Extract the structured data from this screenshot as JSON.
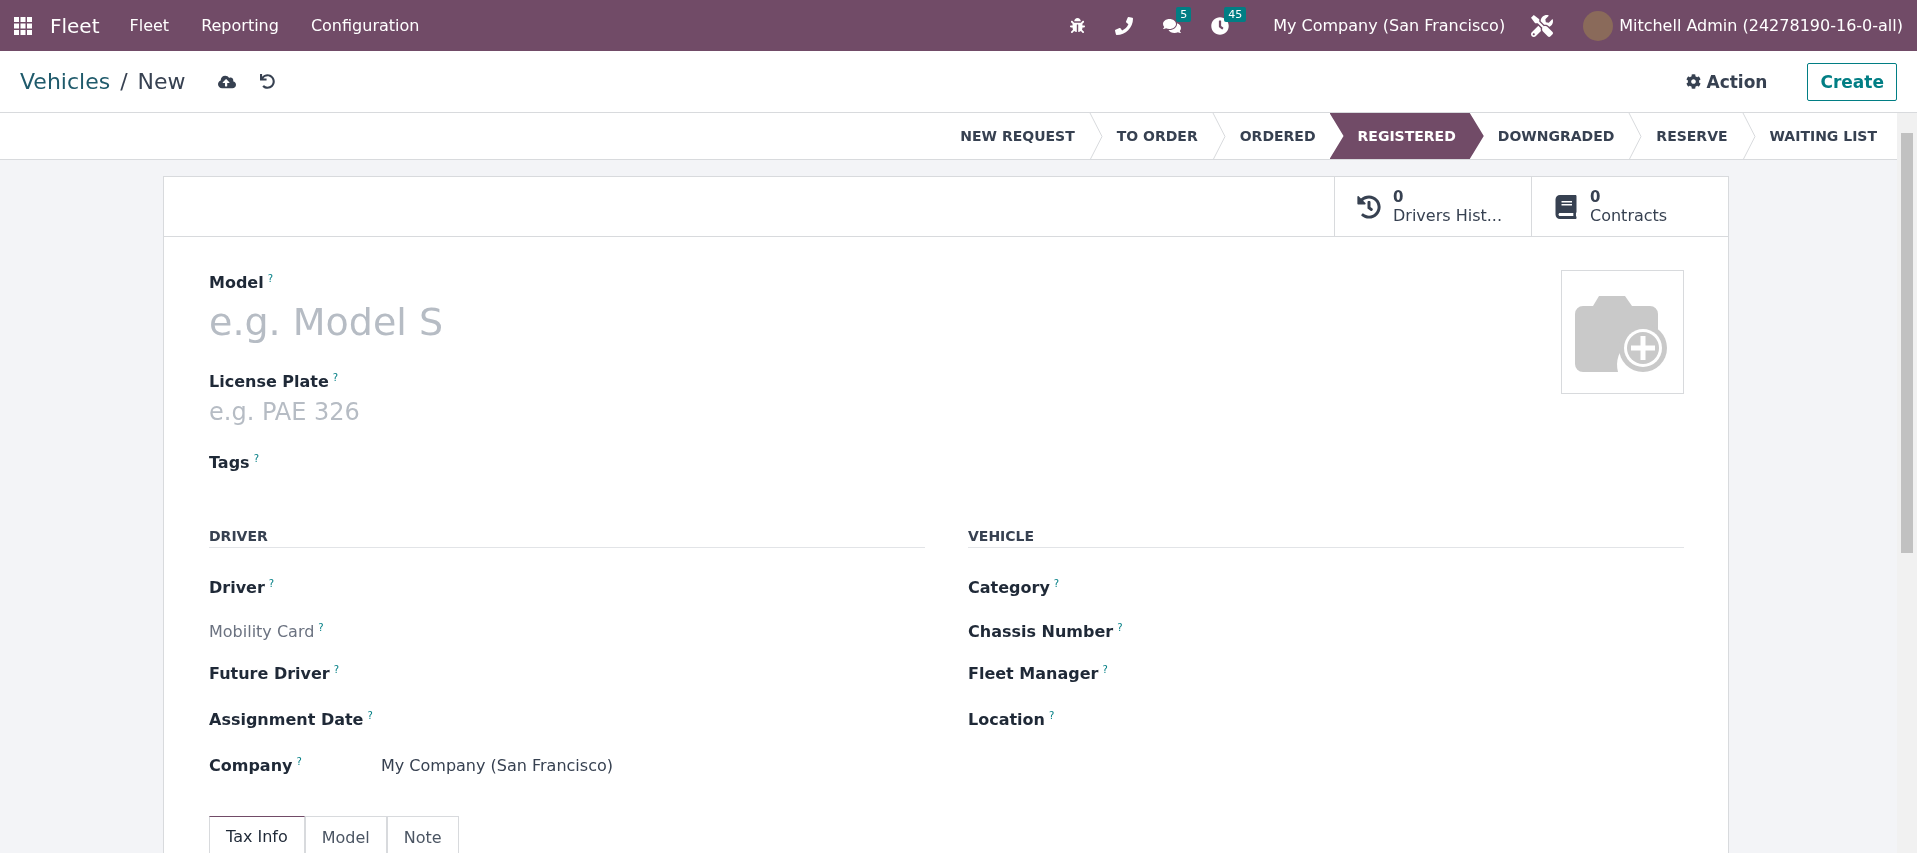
{
  "navbar": {
    "app_name": "Fleet",
    "menu": [
      "Fleet",
      "Reporting",
      "Configuration"
    ],
    "chat_count": "5",
    "activity_count": "45",
    "company": "My Company (San Francisco)",
    "user": "Mitchell Admin (24278190-16-0-all)"
  },
  "control_panel": {
    "breadcrumb": "Vehicles",
    "separator": "/",
    "current": "New",
    "action": "Action",
    "create": "Create"
  },
  "stages": [
    {
      "label": "NEW REQUEST",
      "selected": false
    },
    {
      "label": "TO ORDER",
      "selected": false
    },
    {
      "label": "ORDERED",
      "selected": false
    },
    {
      "label": "REGISTERED",
      "selected": true
    },
    {
      "label": "DOWNGRADED",
      "selected": false
    },
    {
      "label": "RESERVE",
      "selected": false
    },
    {
      "label": "WAITING LIST",
      "selected": false
    }
  ],
  "stat_buttons": [
    {
      "kind": "history",
      "count": "0",
      "label": "Drivers Hist..."
    },
    {
      "kind": "book",
      "count": "0",
      "label": "Contracts"
    }
  ],
  "title_fields": [
    {
      "label": "Model",
      "help": "?",
      "placeholder": "e.g. Model S"
    },
    {
      "label": "License Plate",
      "help": "?",
      "placeholder": "e.g. PAE 326"
    },
    {
      "label": "Tags",
      "help": "?"
    }
  ],
  "groups": [
    {
      "title": "DRIVER",
      "fields": [
        {
          "label": "Driver",
          "help": "?",
          "disabled": false
        },
        {
          "label": "Mobility Card",
          "help": "?",
          "disabled": true
        },
        {
          "label": "Future Driver",
          "help": "?",
          "disabled": false
        },
        {
          "label": "Assignment Date",
          "help": "?",
          "disabled": false
        },
        {
          "label": "Company",
          "help": "?",
          "disabled": false,
          "value": "My Company (San Francisco)"
        }
      ]
    },
    {
      "title": "VEHICLE",
      "fields": [
        {
          "label": "Category",
          "help": "?",
          "disabled": false
        },
        {
          "label": "Chassis Number",
          "help": "?",
          "disabled": false
        },
        {
          "label": "Fleet Manager",
          "help": "?",
          "disabled": false
        },
        {
          "label": "Location",
          "help": "?",
          "disabled": false
        }
      ]
    }
  ],
  "tabs": [
    {
      "label": "Tax Info",
      "selected": true
    },
    {
      "label": "Model",
      "selected": false
    },
    {
      "label": "Note",
      "selected": false
    }
  ]
}
